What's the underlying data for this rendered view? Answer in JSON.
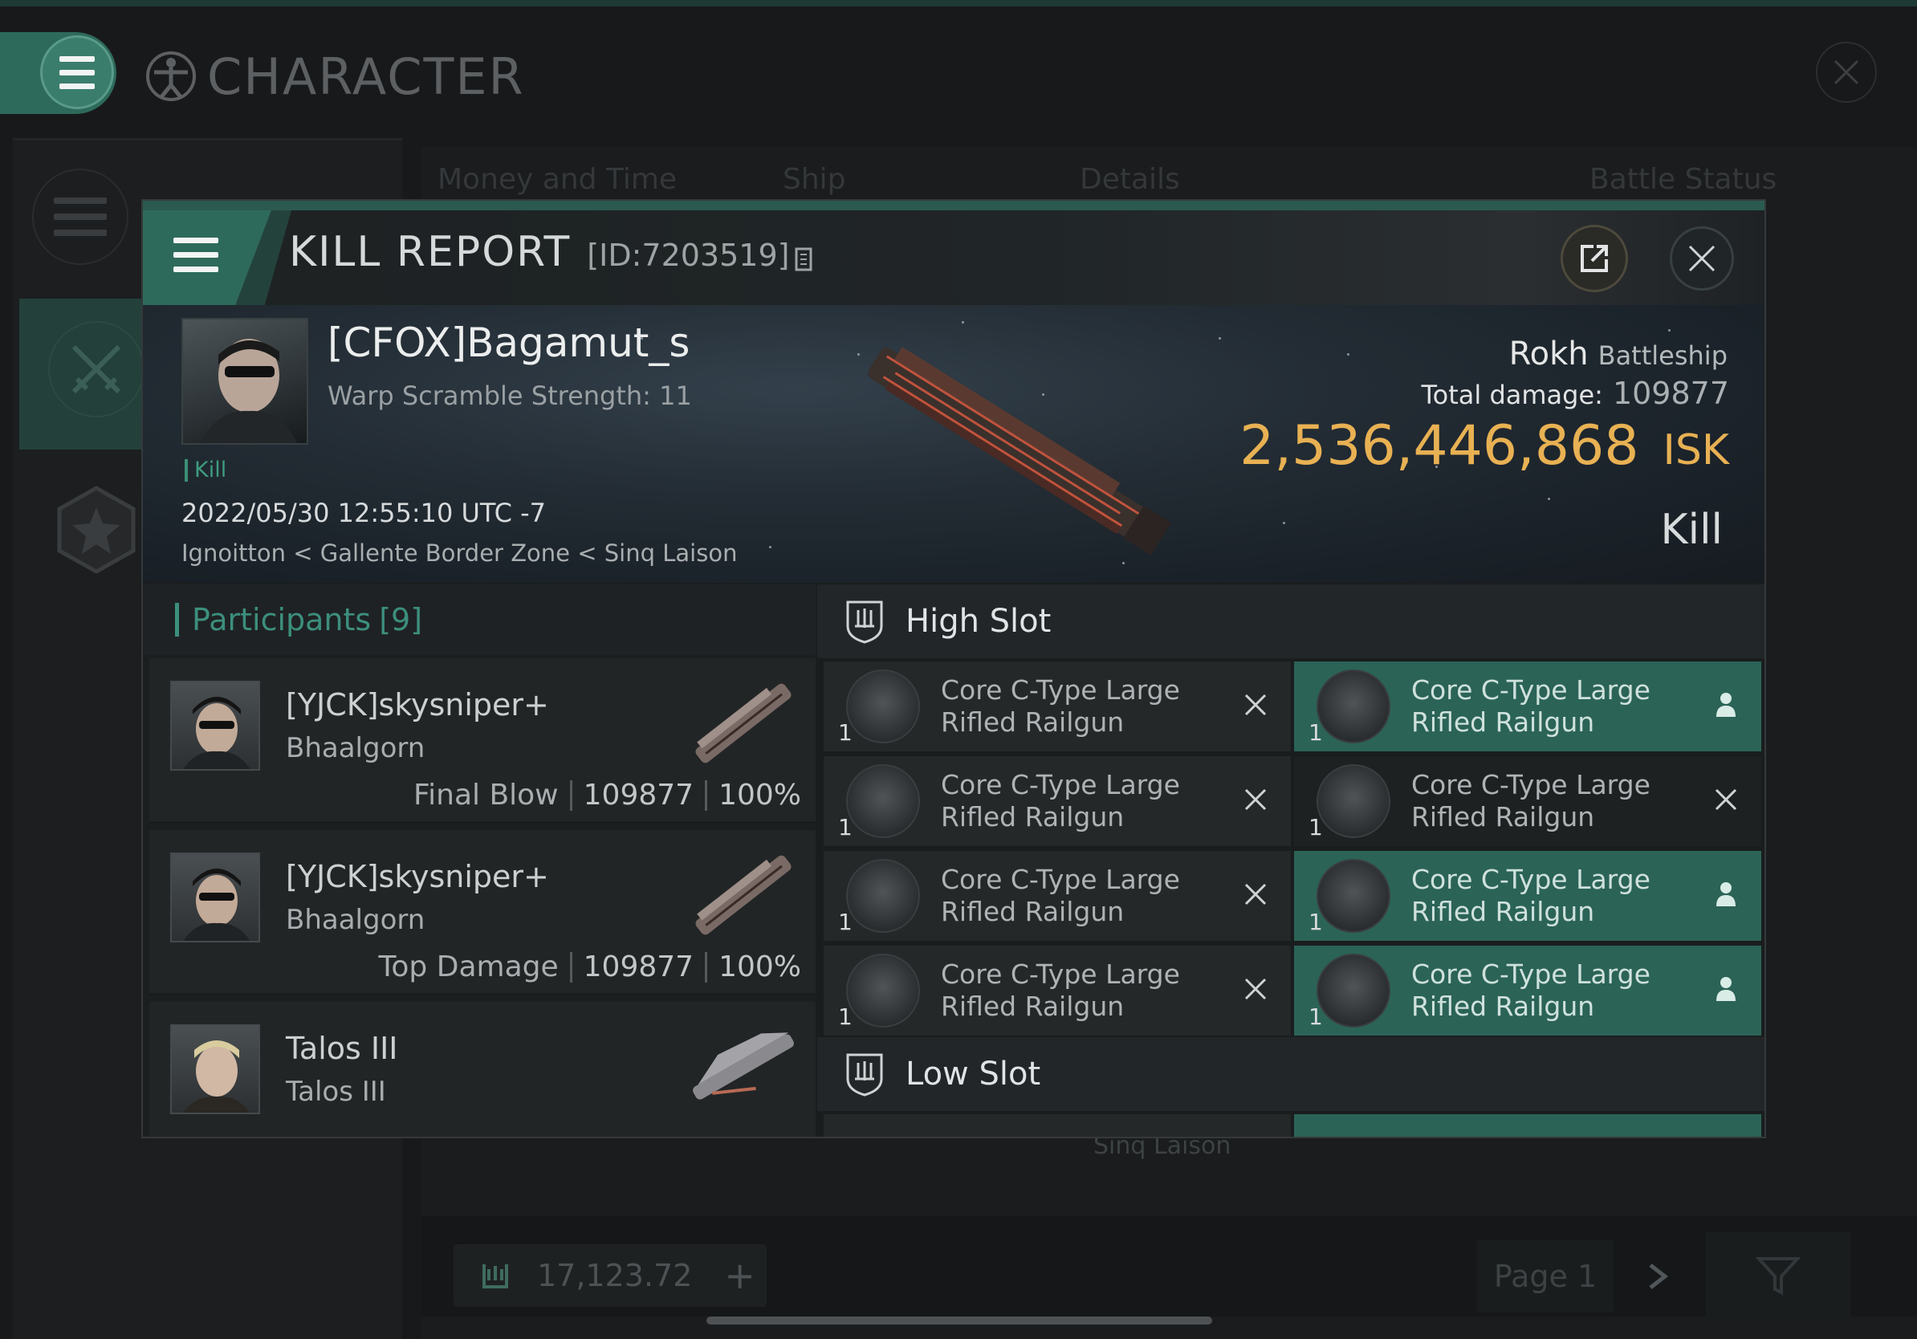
{
  "app": {
    "title": "CHARACTER",
    "list_tabs": [
      "Money and Time",
      "Ship",
      "Details",
      "Battle Status"
    ],
    "balance": "17,123.72",
    "page_label": "Page 1",
    "background_location": "Sinq Laison"
  },
  "kill_report": {
    "title": "KILL REPORT",
    "id_label": "[ID:7203519]",
    "victim": {
      "name": "[CFOX]Bagamut_s",
      "warp_scramble": "Warp Scramble Strength: 11",
      "tag": "Kill",
      "time": "2022/05/30 12:55:10 UTC -7",
      "location": "Ignoitton < Gallente Border Zone < Sinq Laison"
    },
    "ship": {
      "name": "Rokh",
      "class": "Battleship",
      "total_damage_label": "Total damage:",
      "total_damage": "109877",
      "isk_value": "2,536,446,868",
      "isk_unit": "ISK",
      "result": "Kill"
    },
    "participants": {
      "label": "Participants",
      "count": "[9]",
      "rows": [
        {
          "name": "[YJCK]skysniper+",
          "ship": "Bhaalgorn",
          "role": "Final Blow",
          "damage": "109877",
          "percent": "100%"
        },
        {
          "name": "[YJCK]skysniper+",
          "ship": "Bhaalgorn",
          "role": "Top Damage",
          "damage": "109877",
          "percent": "100%"
        },
        {
          "name": "Talos III",
          "ship": "Talos III",
          "role": "",
          "damage": "",
          "percent": ""
        }
      ]
    },
    "slots": {
      "high_slot_label": "High Slot",
      "low_slot_label": "Low Slot",
      "high_modules": [
        {
          "qty": "1",
          "line1": "Core C-Type Large",
          "line2": "Rifled Railgun",
          "status": "destroyed",
          "highlight": false
        },
        {
          "qty": "1",
          "line1": "Core C-Type Large",
          "line2": "Rifled Railgun",
          "status": "dropped",
          "highlight": true
        },
        {
          "qty": "1",
          "line1": "Core C-Type Large",
          "line2": "Rifled Railgun",
          "status": "destroyed",
          "highlight": false
        },
        {
          "qty": "1",
          "line1": "Core C-Type Large",
          "line2": "Rifled Railgun",
          "status": "destroyed",
          "highlight": false
        },
        {
          "qty": "1",
          "line1": "Core C-Type Large",
          "line2": "Rifled Railgun",
          "status": "destroyed",
          "highlight": false
        },
        {
          "qty": "1",
          "line1": "Core C-Type Large",
          "line2": "Rifled Railgun",
          "status": "dropped",
          "highlight": true
        },
        {
          "qty": "1",
          "line1": "Core C-Type Large",
          "line2": "Rifled Railgun",
          "status": "destroyed",
          "highlight": false
        },
        {
          "qty": "1",
          "line1": "Core C-Type Large",
          "line2": "Rifled Railgun",
          "status": "dropped",
          "highlight": true
        }
      ]
    },
    "colors": {
      "accent": "#2e6a5c",
      "highlight_row": "#2b6357",
      "isk": "#e8b153",
      "kill_green": "#3f9c7f"
    }
  }
}
